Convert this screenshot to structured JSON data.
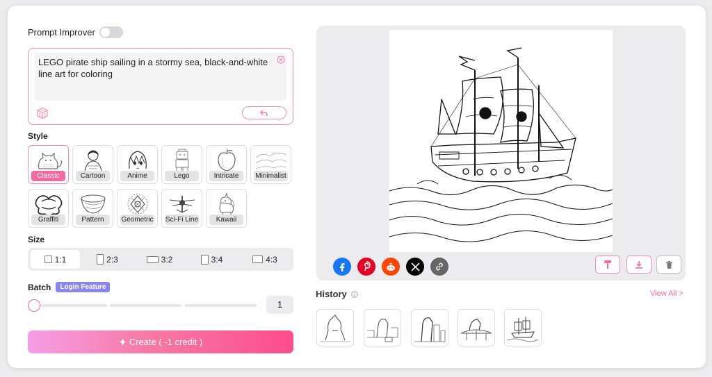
{
  "prompt_improver": {
    "label": "Prompt Improver",
    "enabled": false
  },
  "prompt": {
    "value": "LEGO pirate ship sailing in a stormy sea, black-and-white line art for coloring"
  },
  "style": {
    "label": "Style",
    "selected": "Classic",
    "options": [
      {
        "label": "Classic",
        "icon": "cat-thumbnail-icon"
      },
      {
        "label": "Cartoon",
        "icon": "cartoon-thumbnail-icon"
      },
      {
        "label": "Anime",
        "icon": "anime-thumbnail-icon"
      },
      {
        "label": "Lego",
        "icon": "lego-thumbnail-icon"
      },
      {
        "label": "Intricate",
        "icon": "apple-thumbnail-icon"
      },
      {
        "label": "Minimalist",
        "icon": "landscape-thumbnail-icon"
      },
      {
        "label": "Graffiti",
        "icon": "graffiti-thumbnail-icon"
      },
      {
        "label": "Pattern",
        "icon": "bowl-thumbnail-icon"
      },
      {
        "label": "Geometric",
        "icon": "mandala-thumbnail-icon"
      },
      {
        "label": "Sci-Fi Line",
        "icon": "scifi-thumbnail-icon"
      },
      {
        "label": "Kawaii",
        "icon": "unicorn-thumbnail-icon"
      }
    ]
  },
  "size": {
    "label": "Size",
    "selected": "1:1",
    "options": [
      "1:1",
      "2:3",
      "3:2",
      "3:4",
      "4:3"
    ]
  },
  "batch": {
    "label": "Batch",
    "badge": "Login Feature",
    "value": "1"
  },
  "create_button": {
    "label": "Create ( -1 credit )"
  },
  "share_icons": [
    "facebook-icon",
    "pinterest-icon",
    "reddit-icon",
    "x-icon",
    "link-icon"
  ],
  "actions": [
    "paint-roller-icon",
    "download-icon",
    "trash-icon"
  ],
  "history": {
    "title": "History",
    "view_all": "View All >",
    "thumbnails": [
      "godzilla-thumbnail",
      "kaiju-city-thumbnail",
      "kaiju-tower-thumbnail",
      "kaiju-bridge-thumbnail",
      "pirate-ship-thumbnail"
    ]
  },
  "colors": {
    "accent": "#f4699f",
    "accent_border": "#f58bb5",
    "badge": "#8a86f0",
    "panel_bg": "#ececef"
  }
}
